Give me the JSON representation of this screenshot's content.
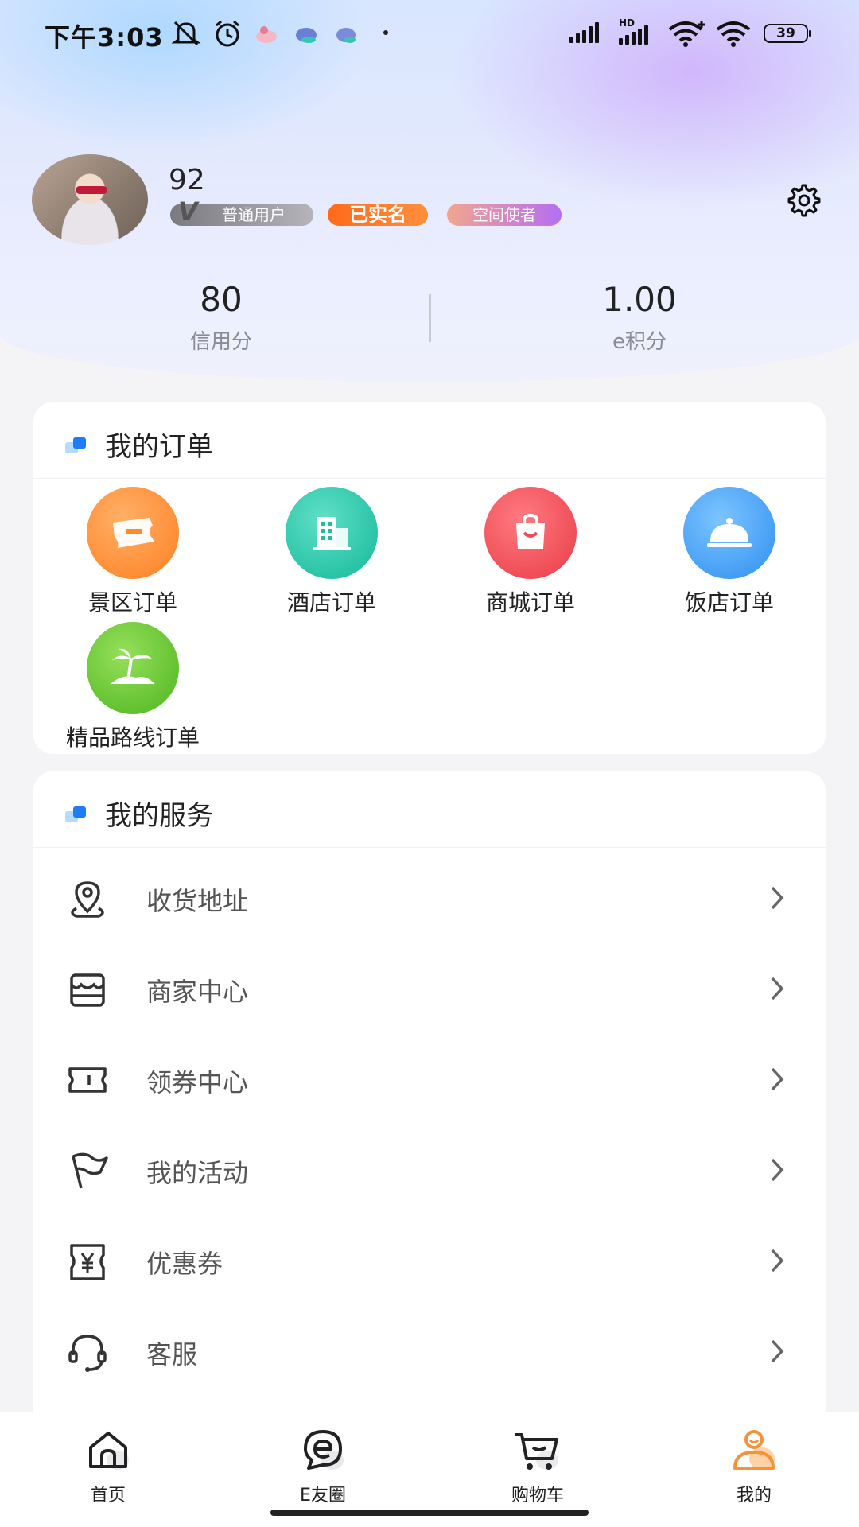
{
  "status_bar": {
    "time": "下午3:03",
    "battery": "39",
    "icons": [
      "mute-bell-icon",
      "alarm-icon",
      "app-notification-icon",
      "app-notification-icon",
      "app-notification-icon",
      "cellular-signal-icon",
      "hd-signal-icon",
      "wifi-plus-icon",
      "wifi-icon",
      "battery-icon"
    ]
  },
  "profile": {
    "username": "92",
    "tags": {
      "user_level": "普通用户",
      "verified": "已实名",
      "ambassador": "空间使者"
    },
    "settings_icon": "gear-icon"
  },
  "stats": [
    {
      "value": "80",
      "label": "信用分"
    },
    {
      "value": "1.00",
      "label": "e积分"
    }
  ],
  "orders": {
    "title": "我的订单",
    "items": [
      {
        "label": "景区订单",
        "icon": "ticket-icon",
        "color": "#ff8a2b"
      },
      {
        "label": "酒店订单",
        "icon": "building-icon",
        "color": "#21c4a6"
      },
      {
        "label": "商城订单",
        "icon": "shopping-bag-icon",
        "color": "#ef4b55"
      },
      {
        "label": "饭店订单",
        "icon": "dish-cover-icon",
        "color": "#3e9ef5"
      },
      {
        "label": "精品路线订单",
        "icon": "palm-island-icon",
        "color": "#5cc22e"
      }
    ]
  },
  "services": {
    "title": "我的服务",
    "items": [
      {
        "label": "收货地址",
        "icon": "location-pin-icon"
      },
      {
        "label": "商家中心",
        "icon": "store-icon"
      },
      {
        "label": "领券中心",
        "icon": "ticket-outline-icon"
      },
      {
        "label": "我的活动",
        "icon": "flag-icon"
      },
      {
        "label": "优惠券",
        "icon": "yen-coupon-icon"
      },
      {
        "label": "客服",
        "icon": "headset-icon"
      }
    ]
  },
  "tabbar": {
    "items": [
      {
        "label": "首页",
        "icon": "home-icon"
      },
      {
        "label": "E友圈",
        "icon": "e-chat-icon"
      },
      {
        "label": "购物车",
        "icon": "cart-icon"
      },
      {
        "label": "我的",
        "icon": "user-icon",
        "active": true
      }
    ],
    "active_color": "#f5933a"
  }
}
